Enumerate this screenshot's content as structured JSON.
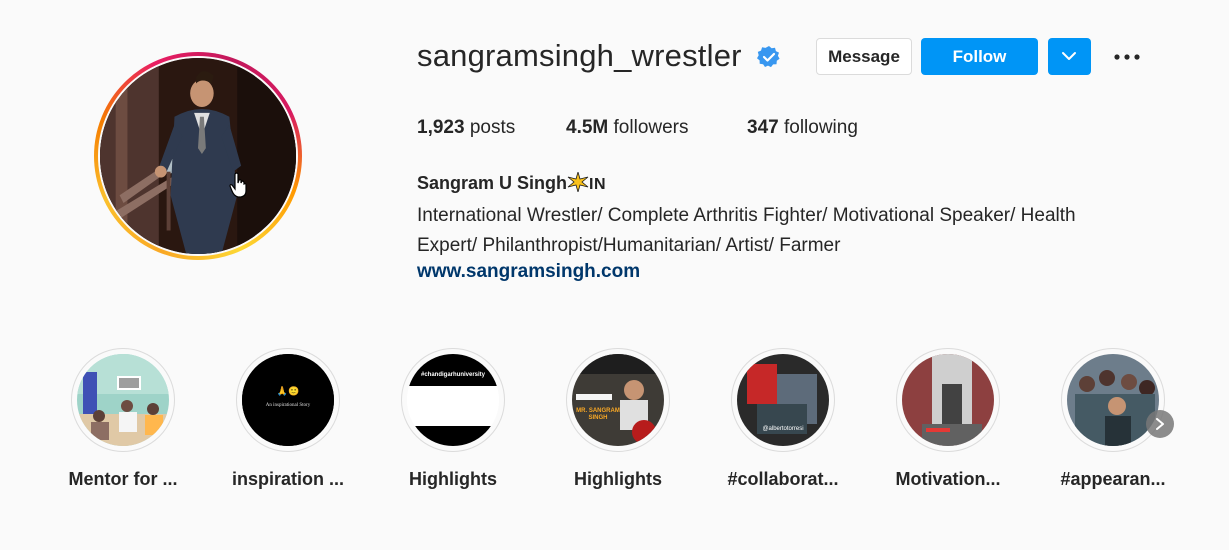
{
  "profile": {
    "username": "sangramsingh_wrestler",
    "verified": true,
    "buttons": {
      "message": "Message",
      "follow": "Follow"
    },
    "stats": [
      {
        "value": "1,923",
        "label": "posts"
      },
      {
        "value": "4.5M",
        "label": "followers"
      },
      {
        "value": "347",
        "label": "following"
      }
    ],
    "full_name": "Sangram U Singh",
    "name_badge": "IN",
    "bio_line1": "International Wrestler/ Complete Arthritis Fighter/ Motivational Speaker/ Health",
    "bio_line2": "Expert/ Philanthropist/Humanitarian/ Artist/ Farmer",
    "website": "www.sangramsingh.com"
  },
  "highlights": [
    {
      "label": "Mentor for ...",
      "icon": "office-scene"
    },
    {
      "label": "inspiration ...",
      "text": "An inspirational Story"
    },
    {
      "label": "Highlights",
      "text": "#chandigarhuniversity"
    },
    {
      "label": "Highlights",
      "text": "MR. SANGRAM SINGH"
    },
    {
      "label": "#collaborat...",
      "text": "@albertotorresi"
    },
    {
      "label": "Motivation...",
      "icon": "gym-scene"
    },
    {
      "label": "#appearan...",
      "icon": "crowd-scene"
    }
  ],
  "colors": {
    "accent": "#0095f6",
    "link": "#00376b",
    "text": "#262626",
    "background": "#fafafa"
  }
}
